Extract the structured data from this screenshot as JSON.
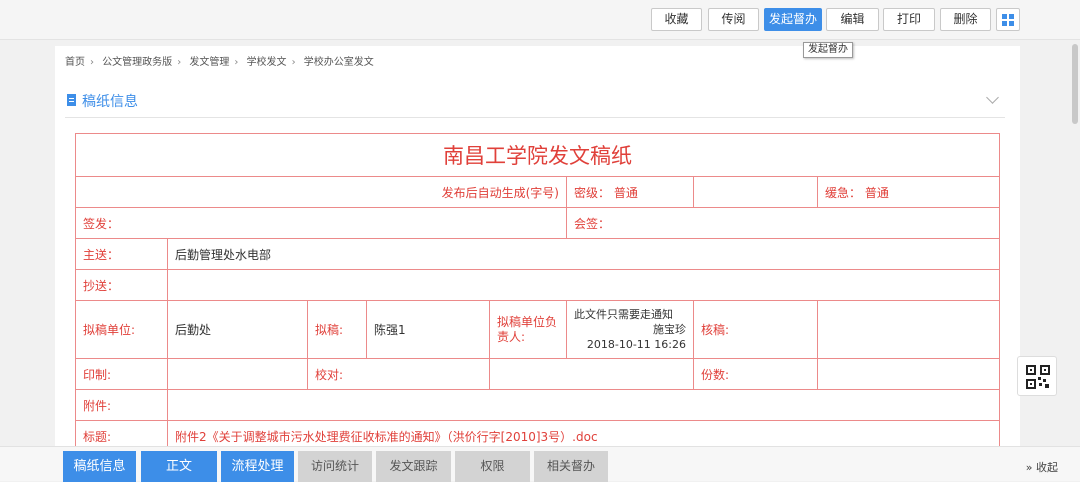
{
  "toolbar": {
    "buttons": [
      "收藏",
      "传阅",
      "发起督办",
      "编辑",
      "打印",
      "删除"
    ],
    "tooltip": "发起督办"
  },
  "breadcrumb": [
    "首页",
    "公文管理政务版",
    "发文管理",
    "学校发文",
    "学校办公室发文"
  ],
  "section": {
    "title": "稿纸信息"
  },
  "form": {
    "title": "南昌工学院发文稿纸",
    "doc_number": "发布后自动生成(字号)",
    "secret_label": "密级：",
    "secret_value": "普通",
    "urgency_label": "缓急：",
    "urgency_value": "普通",
    "sign_label": "签发：",
    "countersign_label": "会签：",
    "send_to_label": "主送：",
    "send_to_value": "后勤管理处水电部",
    "cc_label": "抄送：",
    "draft_unit_label": "拟稿单位:",
    "draft_unit_value": "后勤处",
    "drafter_label": "拟稿:",
    "drafter_value": "陈强1",
    "unit_head_label": "拟稿单位负责人:",
    "unit_head_note": "此文件只需要走通知",
    "unit_head_name": "施宝珍",
    "unit_head_time": "2018-10-11 16:26",
    "review_label": "核稿:",
    "print_label": "印制:",
    "proof_label": "校对:",
    "copies_label": "份数:",
    "attach_label": "附件:",
    "subject_label": "标题:",
    "subject_value": "附件2《关于调整城市污水处理费征收标准的通知》（洪价行字[2010]3号）.doc"
  },
  "bottom_tabs": [
    "稿纸信息",
    "正文",
    "流程处理",
    "访问统计",
    "发文跟踪",
    "权限",
    "相关督办"
  ],
  "collapse_label": "收起",
  "colors": {
    "accent": "#3d8ee8",
    "form_red": "#e0403a",
    "border_red": "#ec8a8a"
  }
}
